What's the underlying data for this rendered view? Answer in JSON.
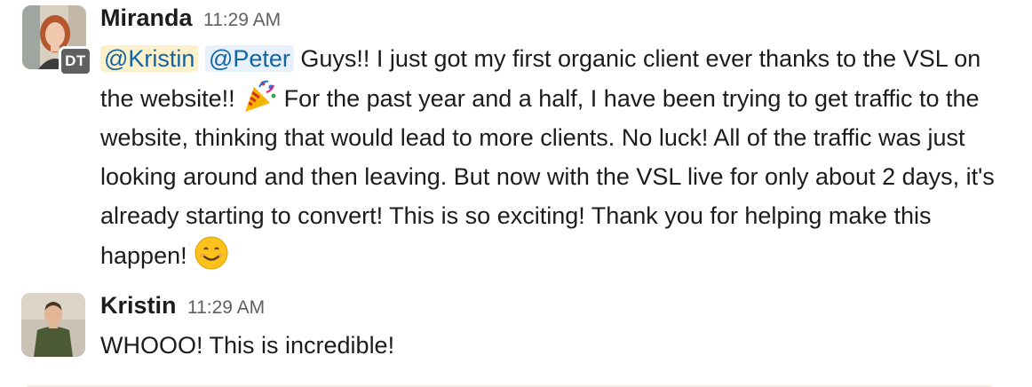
{
  "messages": [
    {
      "author": "Miranda",
      "time": "11:29 AM",
      "badge": "DT",
      "mentions": [
        "@Kristin",
        "@Peter"
      ],
      "text_part1": " Guys!! I just got my first organic client ever thanks to the VSL on the website!! ",
      "emoji1": "party-popper",
      "text_part2": " For the past year and a half, I have been trying to get traffic to the website, thinking that would lead to more clients. No luck! All of the traffic was just looking around and then leaving. But now with the VSL live for only about 2 days, it's already starting to convert! This is so exciting! Thank you for helping make this happen! ",
      "emoji2": "smiling-face"
    },
    {
      "author": "Kristin",
      "time": "11:29 AM",
      "text": "WHOOO! This is incredible!"
    }
  ],
  "colors": {
    "text": "#1d1c1d",
    "timestamp": "#616061",
    "mention_text": "#1264a3",
    "mention_bg_1": "#fdf1cc",
    "mention_bg_2": "#e8f1fb",
    "badge_bg": "#616061"
  }
}
